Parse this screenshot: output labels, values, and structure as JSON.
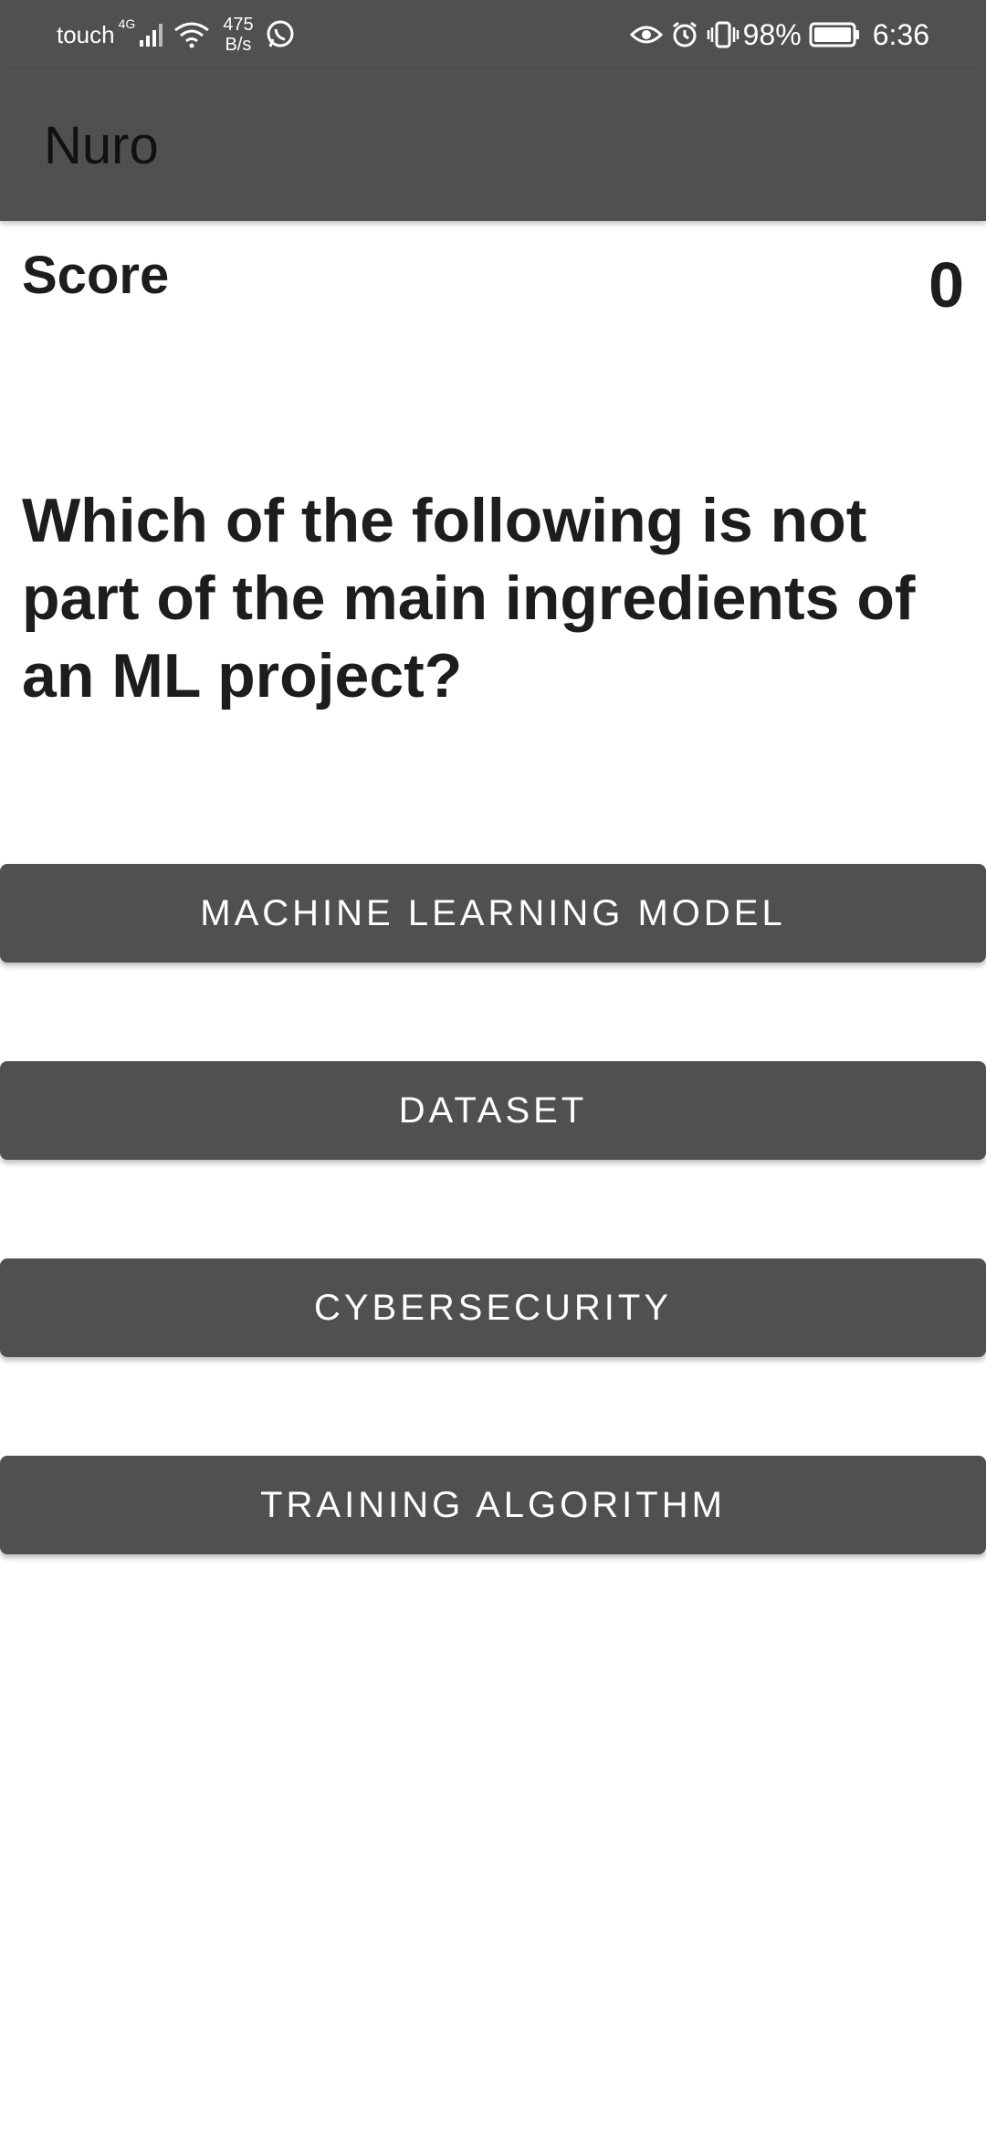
{
  "status_bar": {
    "carrier": "touch",
    "network_type": "4G",
    "speed_value": "475",
    "speed_unit": "B/s",
    "battery_percent": "98%",
    "time": "6:36",
    "icons": [
      "signal-icon",
      "wifi-icon",
      "whatsapp-icon",
      "eye-icon",
      "alarm-icon",
      "vibrate-icon",
      "battery-icon"
    ]
  },
  "app_bar": {
    "title": "Nuro"
  },
  "score": {
    "label": "Score",
    "value": "0"
  },
  "question": {
    "text": "Which of the following is not part of the main ingredients of an ML project?"
  },
  "answers": [
    {
      "label": "MACHINE LEARNING MODEL"
    },
    {
      "label": "DATASET"
    },
    {
      "label": "CYBERSECURITY"
    },
    {
      "label": "TRAINING ALGORITHM"
    }
  ],
  "colors": {
    "bar_background": "#505050",
    "button_background": "#505050",
    "button_text": "#ffffff",
    "text_dark": "#1d1d1d"
  }
}
